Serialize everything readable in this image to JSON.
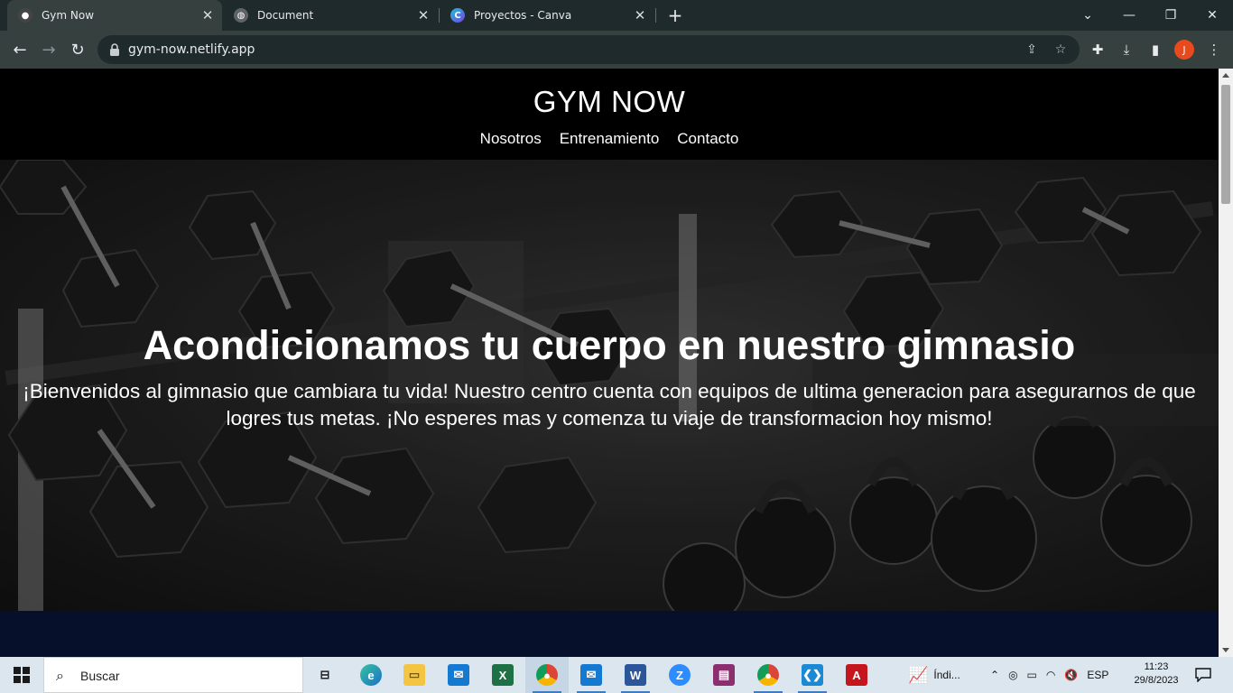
{
  "browser": {
    "tabs": [
      {
        "title": "Gym Now",
        "active": true
      },
      {
        "title": "Document",
        "active": false
      },
      {
        "title": "Proyectos - Canva",
        "active": false
      }
    ],
    "url": "gym-now.netlify.app",
    "profile_initial": "J"
  },
  "site": {
    "brand": "GYM NOW",
    "nav": [
      "Nosotros",
      "Entrenamiento",
      "Contacto"
    ],
    "hero": {
      "title": "Acondicionamos tu cuerpo en nuestro gimnasio",
      "text": "¡Bienvenidos al gimnasio que cambiara tu vida! Nuestro centro cuenta con equipos de ultima generacion para asegurarnos de que logres tus metas. ¡No esperes mas y comenza tu viaje de transformacion hoy mismo!"
    },
    "colors": {
      "header_bg": "#000000",
      "next_section_bg": "#06102a"
    }
  },
  "taskbar": {
    "search_placeholder": "Buscar",
    "apps": [
      "task-view",
      "edge",
      "file-explorer",
      "mail",
      "excel",
      "chrome",
      "mail",
      "word",
      "zoom",
      "winrar",
      "chrome",
      "vscode",
      "acrobat"
    ],
    "weather_label": "Índi...",
    "language": "ESP",
    "time": "11:23",
    "date": "29/8/2023"
  }
}
